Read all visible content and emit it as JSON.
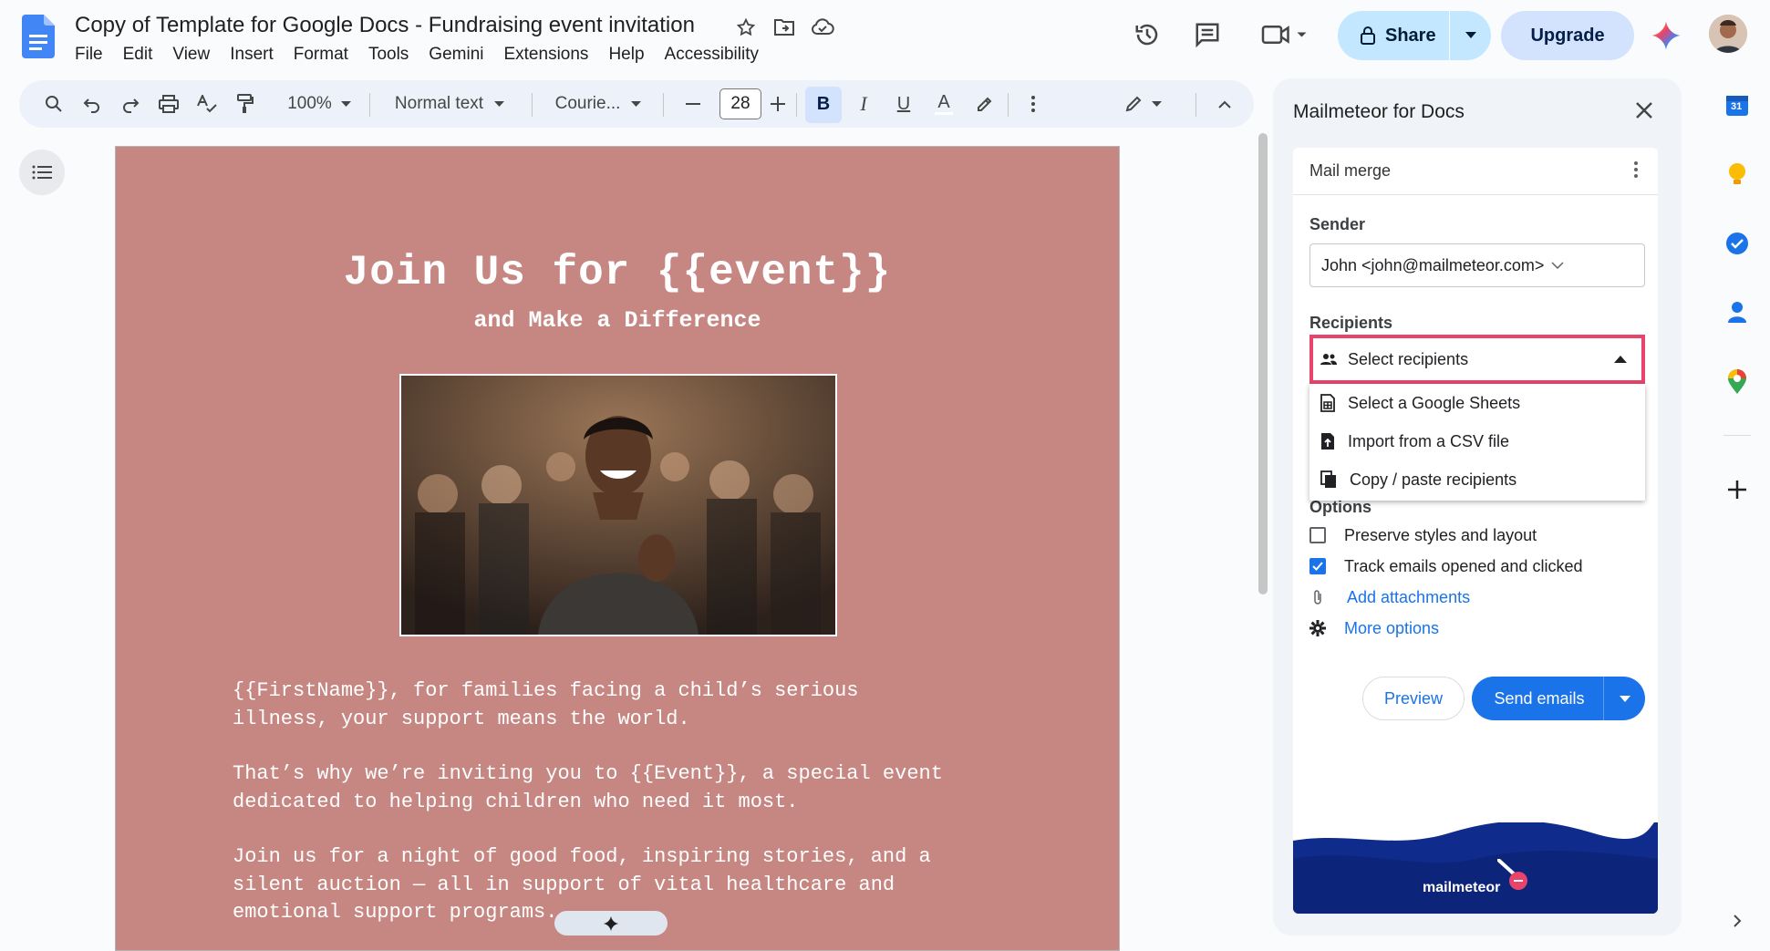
{
  "doc": {
    "title": "Copy of Template for Google Docs - Fundraising event invitation"
  },
  "menu": [
    "File",
    "Edit",
    "View",
    "Insert",
    "Format",
    "Tools",
    "Gemini",
    "Extensions",
    "Help",
    "Accessibility"
  ],
  "header": {
    "share_label": "Share",
    "upgrade_label": "Upgrade"
  },
  "toolbar": {
    "zoom": "100%",
    "style": "Normal text",
    "font": "Courie...",
    "font_size": "28",
    "bold": "B",
    "italic": "I",
    "underline": "U",
    "text_color": "A"
  },
  "page": {
    "heading": "Join Us for {{event}}",
    "subheading": "and Make a Difference",
    "para1": "{{FirstName}}, for families facing a child’s serious\nillness, your support means the world.",
    "para2": "That’s why we’re inviting you to {{Event}}, a special event\ndedicated to helping children who need it most.",
    "para3": "Join us for a night of good food, inspiring stories, and a\nsilent auction — all in support of vital healthcare and\nemotional support programs.",
    "background_color": "#c68782"
  },
  "sidepanel": {
    "title": "Mailmeteor for Docs",
    "mode": "Mail merge",
    "sender_label": "Sender",
    "sender_value": "John <john@mailmeteor.com>",
    "recipients_label": "Recipients",
    "recipients_placeholder": "Select recipients",
    "recipient_options": [
      "Select a Google Sheets",
      "Import from a CSV file",
      "Copy / paste recipients"
    ],
    "options_label": "Options",
    "option_preserve": "Preserve styles and layout",
    "option_preserve_checked": false,
    "option_track": "Track emails opened and clicked",
    "option_track_checked": true,
    "add_attachments": "Add attachments",
    "more_options": "More options",
    "preview_label": "Preview",
    "send_label": "Send emails",
    "brand": "mailmeteor",
    "highlight_color": "#e8436b"
  },
  "rail": {
    "calendar_badge": "31"
  }
}
